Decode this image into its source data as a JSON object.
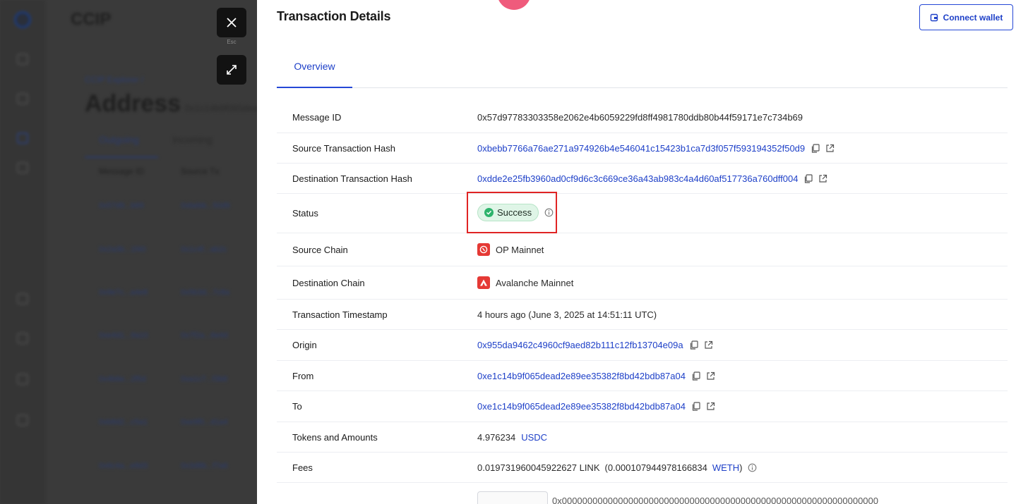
{
  "background": {
    "brand": "CCIP",
    "breadcrumb": "CCIP Explorer /",
    "title": "Address",
    "subtitle": "0x1c14b9f065dead2e89ee",
    "tabs": [
      "Outgoing",
      "Incoming"
    ],
    "columns": [
      "Message ID",
      "Source Tx"
    ],
    "rows": [
      {
        "a": "0x57d9...b69",
        "b": "0xbebb...50d9"
      },
      {
        "a": "0x2a3b...1f40",
        "b": "0x1c4f...ab2c"
      },
      {
        "a": "0x9e7c...a4e8",
        "b": "0x5b3d...7c8a"
      },
      {
        "a": "0xe4d1...9a10",
        "b": "0x7f2a...6e4d"
      },
      {
        "a": "0x4b6e...2f5d",
        "b": "0xa1c7...f3b8"
      },
      {
        "a": "0xb8d2...c5a1",
        "b": "0xe9f0...d1a4"
      },
      {
        "a": "0x6c4a...e8d3",
        "b": "0x3d8b...f7a6"
      }
    ]
  },
  "controls": {
    "close_hint": "Esc"
  },
  "panel": {
    "title": "Transaction Details",
    "connect_wallet_label": "Connect wallet",
    "tabs": [
      "Overview"
    ],
    "details": {
      "message_id": {
        "label": "Message ID",
        "value": "0x57d97783303358e2062e4b6059229fd8ff4981780ddb80b44f59171e7c734b69"
      },
      "source_tx": {
        "label": "Source Transaction Hash",
        "value": "0xbebb7766a76ae271a974926b4e546041c15423b1ca7d3f057f593194352f50d9"
      },
      "dest_tx": {
        "label": "Destination Transaction Hash",
        "value": "0xdde2e25fb3960ad0cf9d6c3c669ce36a43ab983c4a4d60af517736a760dff004"
      },
      "status": {
        "label": "Status",
        "value": "Success"
      },
      "source_chain": {
        "label": "Source Chain",
        "value": "OP Mainnet"
      },
      "dest_chain": {
        "label": "Destination Chain",
        "value": "Avalanche Mainnet"
      },
      "timestamp": {
        "label": "Transaction Timestamp",
        "value": "4 hours ago (June 3, 2025 at 14:51:11 UTC)"
      },
      "origin": {
        "label": "Origin",
        "value": "0x955da9462c4960cf9aed82b111c12fb13704e09a"
      },
      "from": {
        "label": "From",
        "value": "0xe1c14b9f065dead2e89ee35382f8bd42bdb87a04"
      },
      "to": {
        "label": "To",
        "value": "0xe1c14b9f065dead2e89ee35382f8bd42bdb87a04"
      },
      "tokens": {
        "label": "Tokens and Amounts",
        "amount": "4.976234",
        "token": "USDC"
      },
      "fees": {
        "label": "Fees",
        "link_amount": "0.019731960045922627 LINK",
        "paren_open": "(0.000107944978166834",
        "weth": "WETH",
        "paren_close": ")"
      }
    },
    "next_row_value": "0x00000000000000000000000000000000000000000000000000000000000000"
  },
  "colors": {
    "accent": "#1e40c8",
    "success": "#2db36b",
    "highlight": "#e02424",
    "chain_red": "#e53935"
  },
  "icons": [
    "close-icon",
    "expand-icon",
    "wallet-icon",
    "copy-icon",
    "external-link-icon",
    "check-icon",
    "info-icon",
    "op-logo-icon",
    "avalanche-logo-icon"
  ]
}
